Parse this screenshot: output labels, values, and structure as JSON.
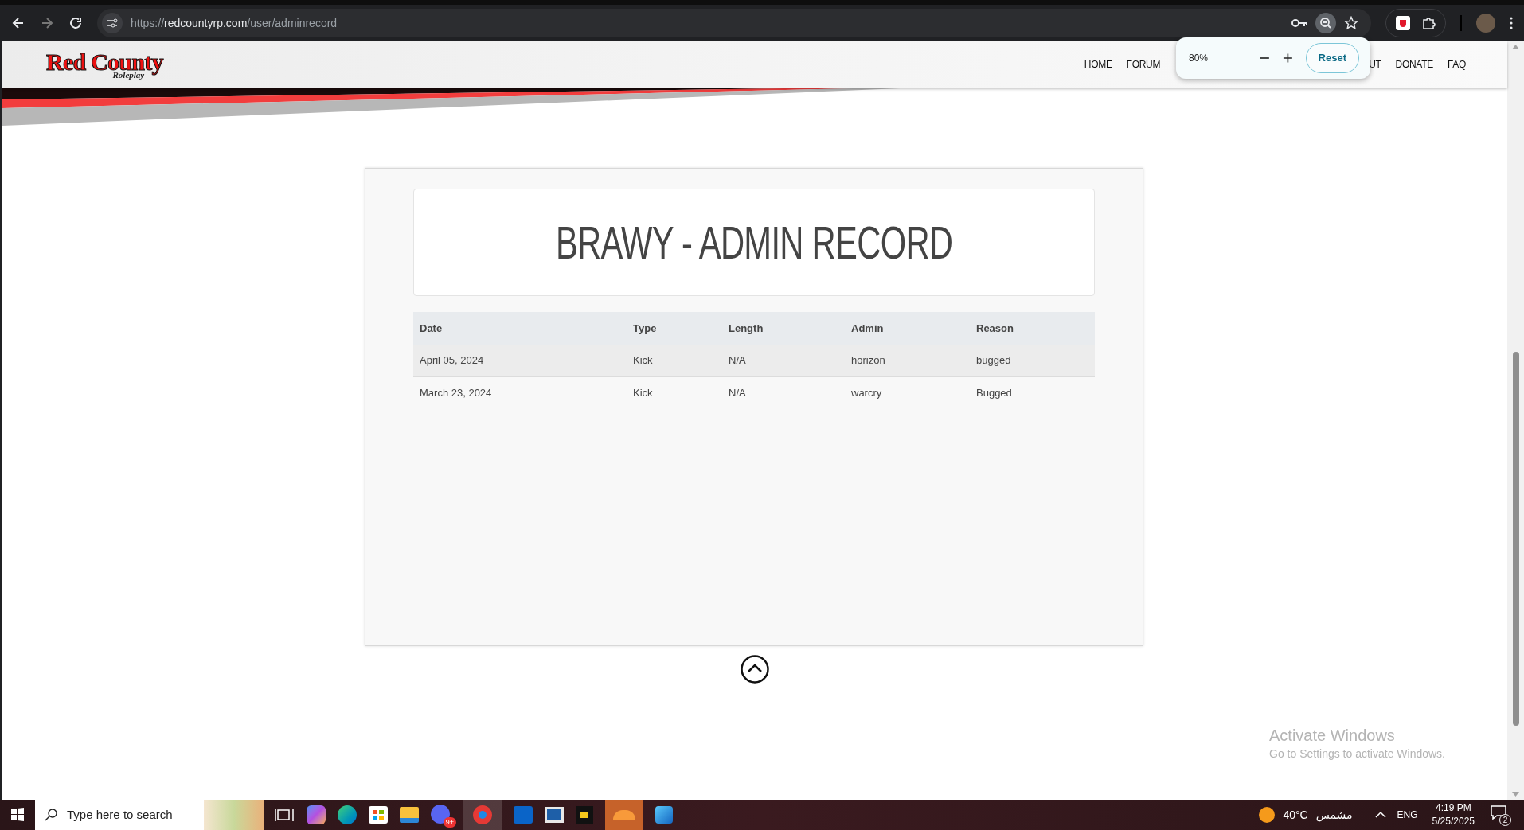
{
  "browser": {
    "url_scheme": "https://",
    "url_host": "redcountyrp.com",
    "url_path": "/user/adminrecord"
  },
  "zoom_popup": {
    "level": "80%",
    "reset": "Reset"
  },
  "site": {
    "logo": "Red County",
    "logo_sub": "Roleplay",
    "nav": [
      "HOME",
      "FORUM",
      "UT",
      "DONATE",
      "FAQ"
    ]
  },
  "record": {
    "title": "BRAWY - ADMIN RECORD",
    "columns": [
      "Date",
      "Type",
      "Length",
      "Admin",
      "Reason"
    ],
    "rows": [
      {
        "cells": [
          "April 05, 2024",
          "Kick",
          "N/A",
          "horizon",
          "bugged"
        ]
      },
      {
        "cells": [
          "March 23, 2024",
          "Kick",
          "N/A",
          "warcry",
          "Bugged"
        ]
      }
    ]
  },
  "activation_notice": {
    "title": "Activate Windows",
    "text": "Go to Settings to activate Windows."
  },
  "taskbar": {
    "search_placeholder": "Type here to search",
    "app_badge": "9+",
    "weather_temp": "40°C",
    "weather_condition": "مشمس",
    "language": "ENG",
    "time": "4:19 PM",
    "date": "5/25/2025",
    "notifications": "2"
  }
}
